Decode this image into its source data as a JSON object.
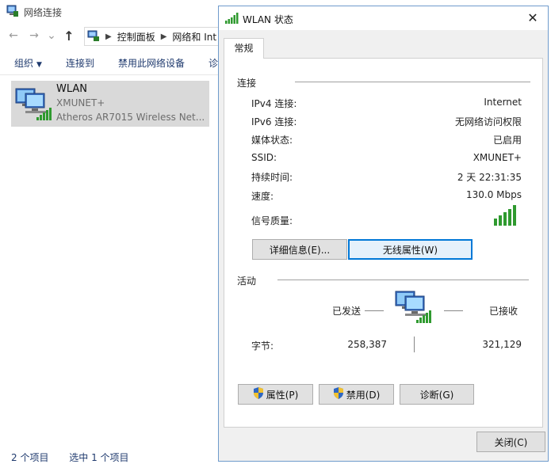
{
  "explorer": {
    "title": "网络连接",
    "nav": {
      "back": "←",
      "forward": "→",
      "dropdown": "⌄",
      "up": "↑"
    },
    "breadcrumb": [
      "控制面板",
      "网络和 Int"
    ],
    "toolbar": {
      "organize": "组织",
      "connect_to": "连接到",
      "disable": "禁用此网络设备",
      "diagnose_partial": "诊"
    },
    "connection": {
      "name": "WLAN",
      "ssid": "XMUNET+",
      "adapter": "Atheros AR7015 Wireless Net..."
    },
    "status": {
      "count": "2 个项目",
      "selected": "选中 1 个项目"
    }
  },
  "dialog": {
    "title": "WLAN 状态",
    "close_glyph": "✕",
    "tab": "常规",
    "connection": {
      "heading": "连接",
      "rows": [
        {
          "label": "IPv4 连接:",
          "value": "Internet"
        },
        {
          "label": "IPv6 连接:",
          "value": "无网络访问权限"
        },
        {
          "label": "媒体状态:",
          "value": "已启用"
        },
        {
          "label": "SSID:",
          "value": "XMUNET+"
        },
        {
          "label": "持续时间:",
          "value": "2 天 22:31:35"
        },
        {
          "label": "速度:",
          "value": "130.0 Mbps"
        }
      ],
      "signal_label": "信号质量:",
      "signal_bars": 5
    },
    "buttons": {
      "details": "详细信息(E)...",
      "wireless": "无线属性(W)"
    },
    "activity": {
      "heading": "活动",
      "sent": "已发送",
      "received": "已接收",
      "bytes_label": "字节:",
      "bytes_sent": "258,387",
      "bytes_received": "321,129"
    },
    "bottom_buttons": {
      "properties": "属性(P)",
      "disable": "禁用(D)",
      "diagnose": "诊断(G)"
    },
    "close": "关闭(C)"
  },
  "icons": {
    "app": "network-connections-icon",
    "network_adapter": "network-computer-icon",
    "signal": "signal-bars-icon",
    "shield": "uac-shield-icon"
  },
  "colors": {
    "accent": "#0078d7",
    "signal": "#2f9a2f",
    "selected_bg": "#d9d9d9",
    "link_text": "#1f3a6e"
  }
}
